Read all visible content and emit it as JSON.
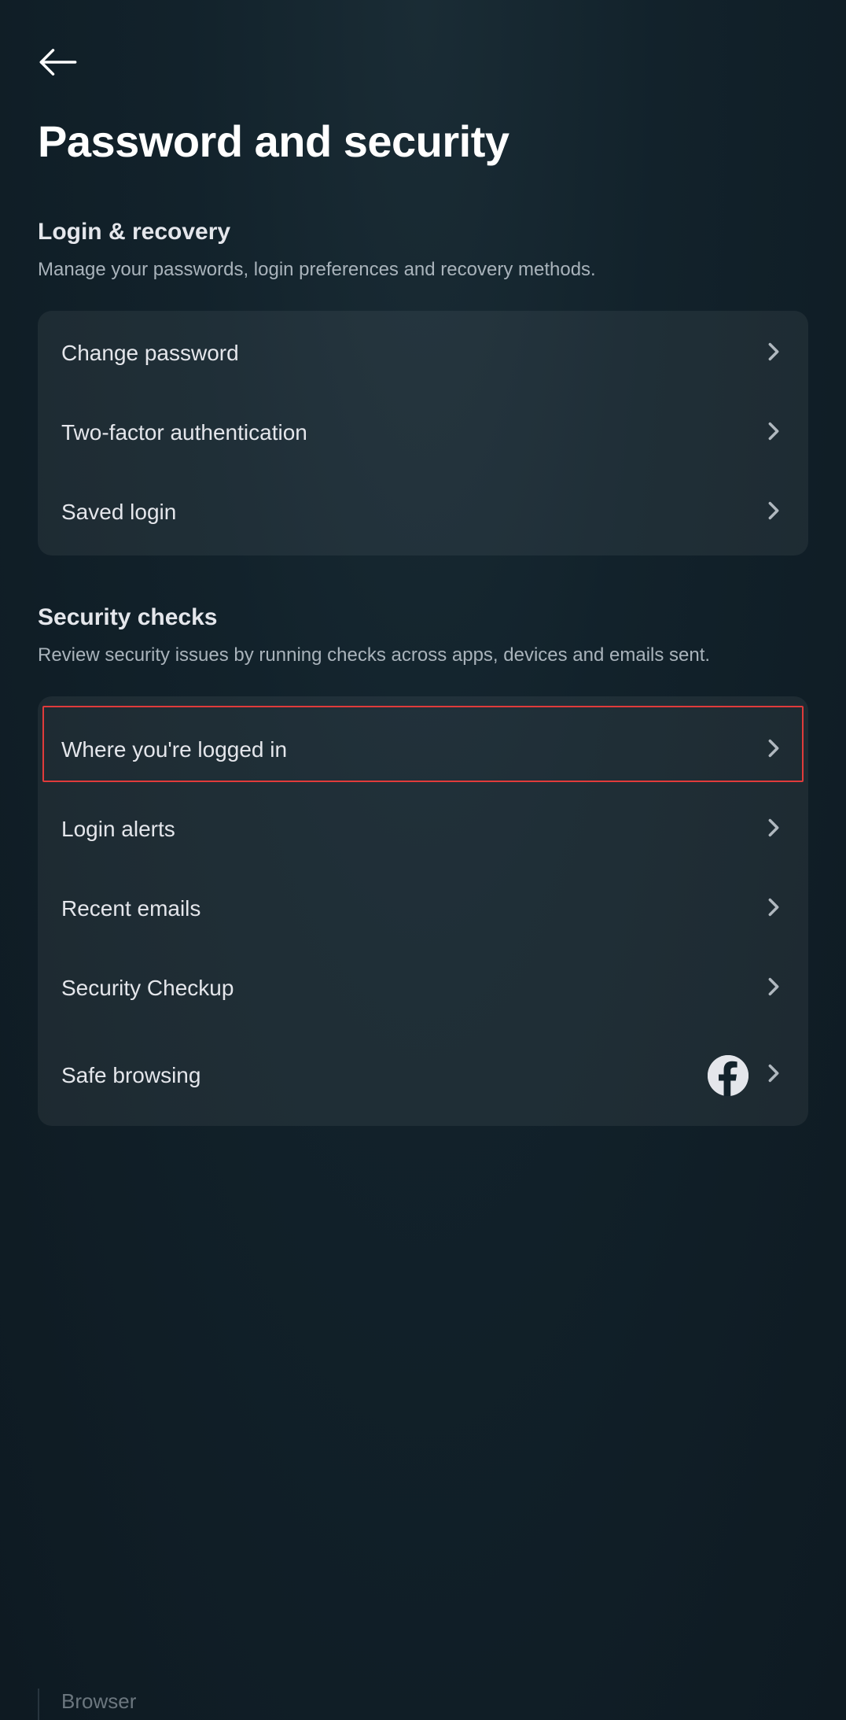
{
  "header": {
    "title": "Password and security"
  },
  "sections": {
    "login_recovery": {
      "title": "Login & recovery",
      "subtitle": "Manage your passwords, login preferences and recovery methods.",
      "items": [
        {
          "label": "Change password"
        },
        {
          "label": "Two-factor authentication"
        },
        {
          "label": "Saved login"
        }
      ]
    },
    "security_checks": {
      "title": "Security checks",
      "subtitle": "Review security issues by running checks across apps, devices and emails sent.",
      "items": [
        {
          "label": "Where you're logged in"
        },
        {
          "label": "Login alerts"
        },
        {
          "label": "Recent emails"
        },
        {
          "label": "Security Checkup"
        },
        {
          "label": "Safe browsing"
        }
      ]
    }
  },
  "fragment": {
    "text": "Browser"
  }
}
